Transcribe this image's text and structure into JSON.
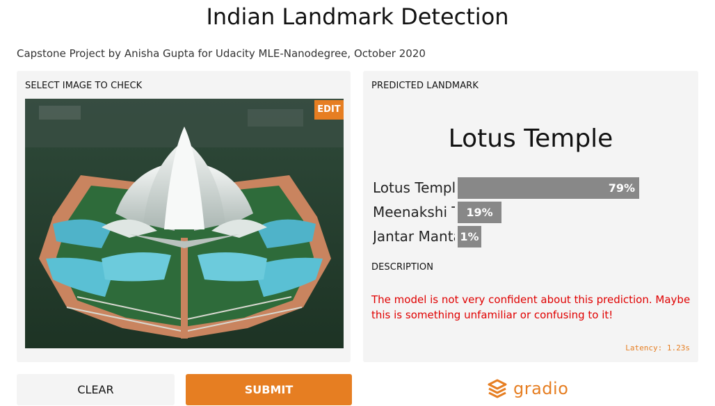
{
  "header": {
    "title": "Indian Landmark Detection",
    "subtitle": "Capstone Project by Anisha Gupta for Udacity MLE-Nanodegree, October 2020"
  },
  "input_panel": {
    "label": "SELECT IMAGE TO CHECK",
    "edit_label": "EDIT",
    "image_subject": "Lotus Temple aerial photo"
  },
  "output_panel": {
    "label": "PREDICTED LANDMARK",
    "predicted": "Lotus Temple",
    "confidences": [
      {
        "label": "Lotus Temple",
        "pct_text": "79%",
        "value": 0.79
      },
      {
        "label": "Meenakshi Temple",
        "pct_text": "19%",
        "value": 0.19
      },
      {
        "label": "Jantar Mantar",
        "pct_text": "1%",
        "value": 0.01
      }
    ],
    "description_label": "DESCRIPTION",
    "description": "The model is not very confident about this prediction. Maybe this is something unfamiliar or confusing to it!",
    "latency": "Latency: 1.23s"
  },
  "buttons": {
    "clear": "CLEAR",
    "submit": "SUBMIT"
  },
  "brand": {
    "name": "gradio",
    "icon": "gradio-logo-icon"
  },
  "colors": {
    "accent": "#e67e22",
    "bar": "#888888",
    "warning": "#e00000",
    "panel_bg": "#f4f4f4"
  }
}
